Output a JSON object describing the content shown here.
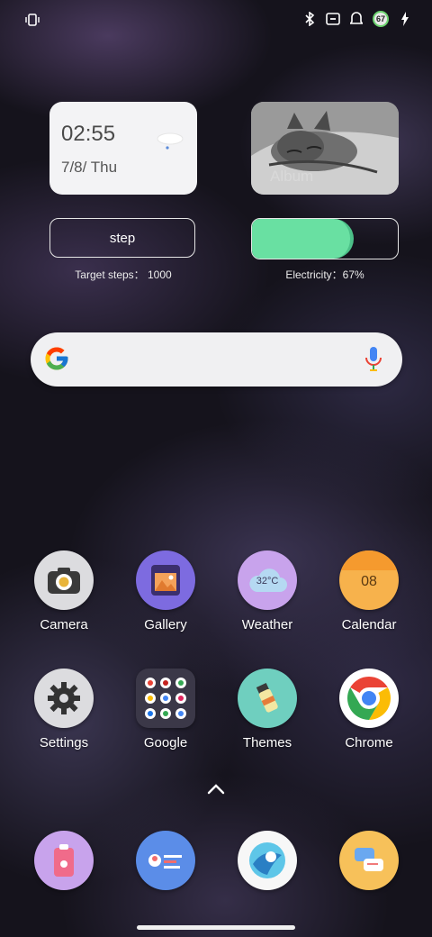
{
  "status_bar": {
    "left_icons": [
      "vibrate-icon"
    ],
    "right_icons": [
      "bluetooth-icon",
      "nfc-icon",
      "notification-icon",
      "battery-icon",
      "charging-icon"
    ],
    "battery_level": "67"
  },
  "clock_widget": {
    "time": "02:55",
    "date": "7/8/ Thu",
    "weather_icon": "cloud-icon"
  },
  "album_widget": {
    "label": "Album"
  },
  "step_widget": {
    "label": "step",
    "caption": "Target steps： 1000"
  },
  "electricity_widget": {
    "caption": "Electricity：67%",
    "level_percent": 67,
    "fill_color": "#69e0a2"
  },
  "search_bar": {
    "left_icon": "google-g-icon",
    "right_icon": "mic-icon"
  },
  "apps_row1": [
    {
      "label": "Camera",
      "icon": "camera-icon"
    },
    {
      "label": "Gallery",
      "icon": "gallery-icon"
    },
    {
      "label": "Weather",
      "icon": "weather-icon",
      "icon_text": "32°C"
    },
    {
      "label": "Calendar",
      "icon": "calendar-icon",
      "icon_text": "08"
    }
  ],
  "apps_row2": [
    {
      "label": "Settings",
      "icon": "settings-icon"
    },
    {
      "label": "Google",
      "icon": "google-folder-icon"
    },
    {
      "label": "Themes",
      "icon": "themes-icon"
    },
    {
      "label": "Chrome",
      "icon": "chrome-icon"
    }
  ],
  "dock": [
    {
      "icon": "phone-icon"
    },
    {
      "icon": "contacts-icon"
    },
    {
      "icon": "browser-icon"
    },
    {
      "icon": "messages-icon"
    }
  ]
}
